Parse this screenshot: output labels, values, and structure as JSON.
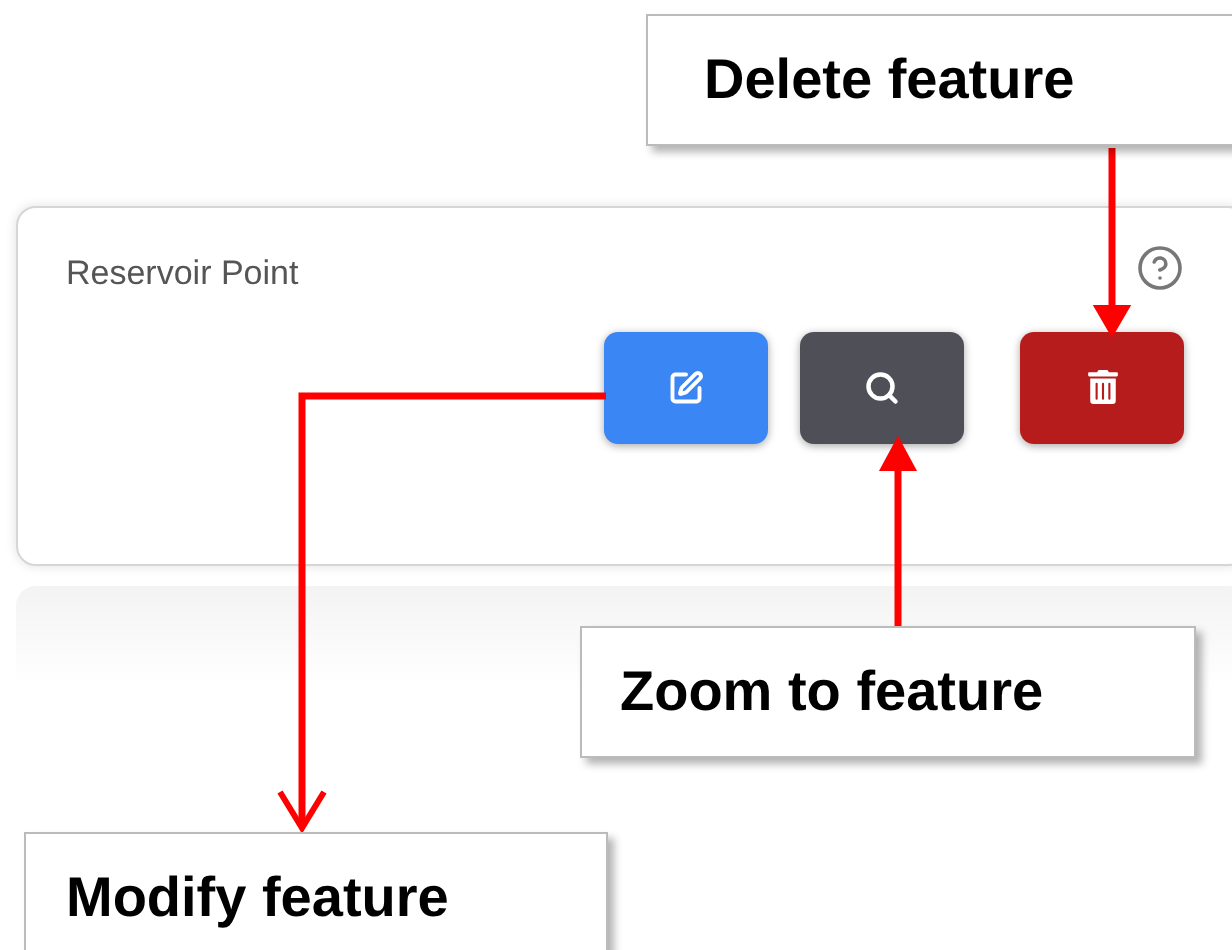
{
  "card": {
    "title": "Reservoir Point",
    "buttons": [
      {
        "kind": "edit"
      },
      {
        "kind": "zoom"
      },
      {
        "kind": "delete"
      }
    ]
  },
  "callouts": [
    {
      "kind": "delete",
      "label": "Delete feature"
    },
    {
      "kind": "zoom",
      "label": "Zoom to feature"
    },
    {
      "kind": "edit",
      "label": "Modify feature"
    }
  ]
}
